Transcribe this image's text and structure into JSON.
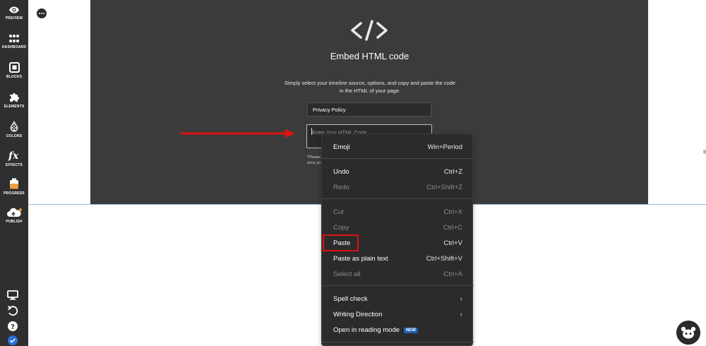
{
  "sidebar": {
    "items": [
      {
        "label": "PREVIEW",
        "icon": "eye-icon"
      },
      {
        "label": "DASHBOARD",
        "icon": "grid-dots-icon"
      },
      {
        "label": "BLOCKS",
        "icon": "block-square-icon"
      },
      {
        "label": "ELEMENTS",
        "icon": "puzzle-piece-icon"
      },
      {
        "label": "COLORS",
        "icon": "checker-drop-icon"
      },
      {
        "label": "EFFECTS",
        "icon": "fx-icon"
      },
      {
        "label": "PROGRESS",
        "icon": "progress-jar-icon"
      },
      {
        "label": "PUBLISH",
        "icon": "cloud-upload-icon"
      }
    ],
    "bottom_icons": [
      "monitor-icon",
      "undo-icon",
      "help-icon",
      "check-badge-icon"
    ]
  },
  "embed": {
    "glyph": "</>",
    "title": "Embed HTML code",
    "description": "Simply select your timeline source, options, and copy and paste the code in the HTML of your page.",
    "source_value": "Privacy Policy",
    "code_placeholder": "Enter Your HTML Code",
    "note_lines": [
      "*Please",
      "once yo"
    ]
  },
  "context_menu": {
    "items": [
      {
        "label": "Emoji",
        "shortcut": "Win+Period",
        "enabled": true
      },
      {
        "label": "Undo",
        "shortcut": "Ctrl+Z",
        "enabled": true
      },
      {
        "label": "Redo",
        "shortcut": "Ctrl+Shift+Z",
        "enabled": false
      },
      {
        "label": "Cut",
        "shortcut": "Ctrl+X",
        "enabled": false
      },
      {
        "label": "Copy",
        "shortcut": "Ctrl+C",
        "enabled": false
      },
      {
        "label": "Paste",
        "shortcut": "Ctrl+V",
        "enabled": true
      },
      {
        "label": "Paste as plain text",
        "shortcut": "Ctrl+Shift+V",
        "enabled": true
      },
      {
        "label": "Select all",
        "shortcut": "Ctrl+A",
        "enabled": false
      },
      {
        "label": "Spell check",
        "shortcut": "",
        "enabled": true,
        "submenu": true
      },
      {
        "label": "Writing Direction",
        "shortcut": "",
        "enabled": true,
        "submenu": true
      },
      {
        "label": "Open in reading mode",
        "shortcut": "",
        "enabled": true,
        "badge": "NEW"
      }
    ]
  },
  "colors": {
    "sidebar_bg": "#2f2f2f",
    "panel_bg": "#3b3b3b",
    "menu_bg": "#2b2b2b",
    "annotation_red": "#e01010",
    "badge_blue": "#1f5fb0",
    "divider_blue": "#9fb5d6"
  }
}
